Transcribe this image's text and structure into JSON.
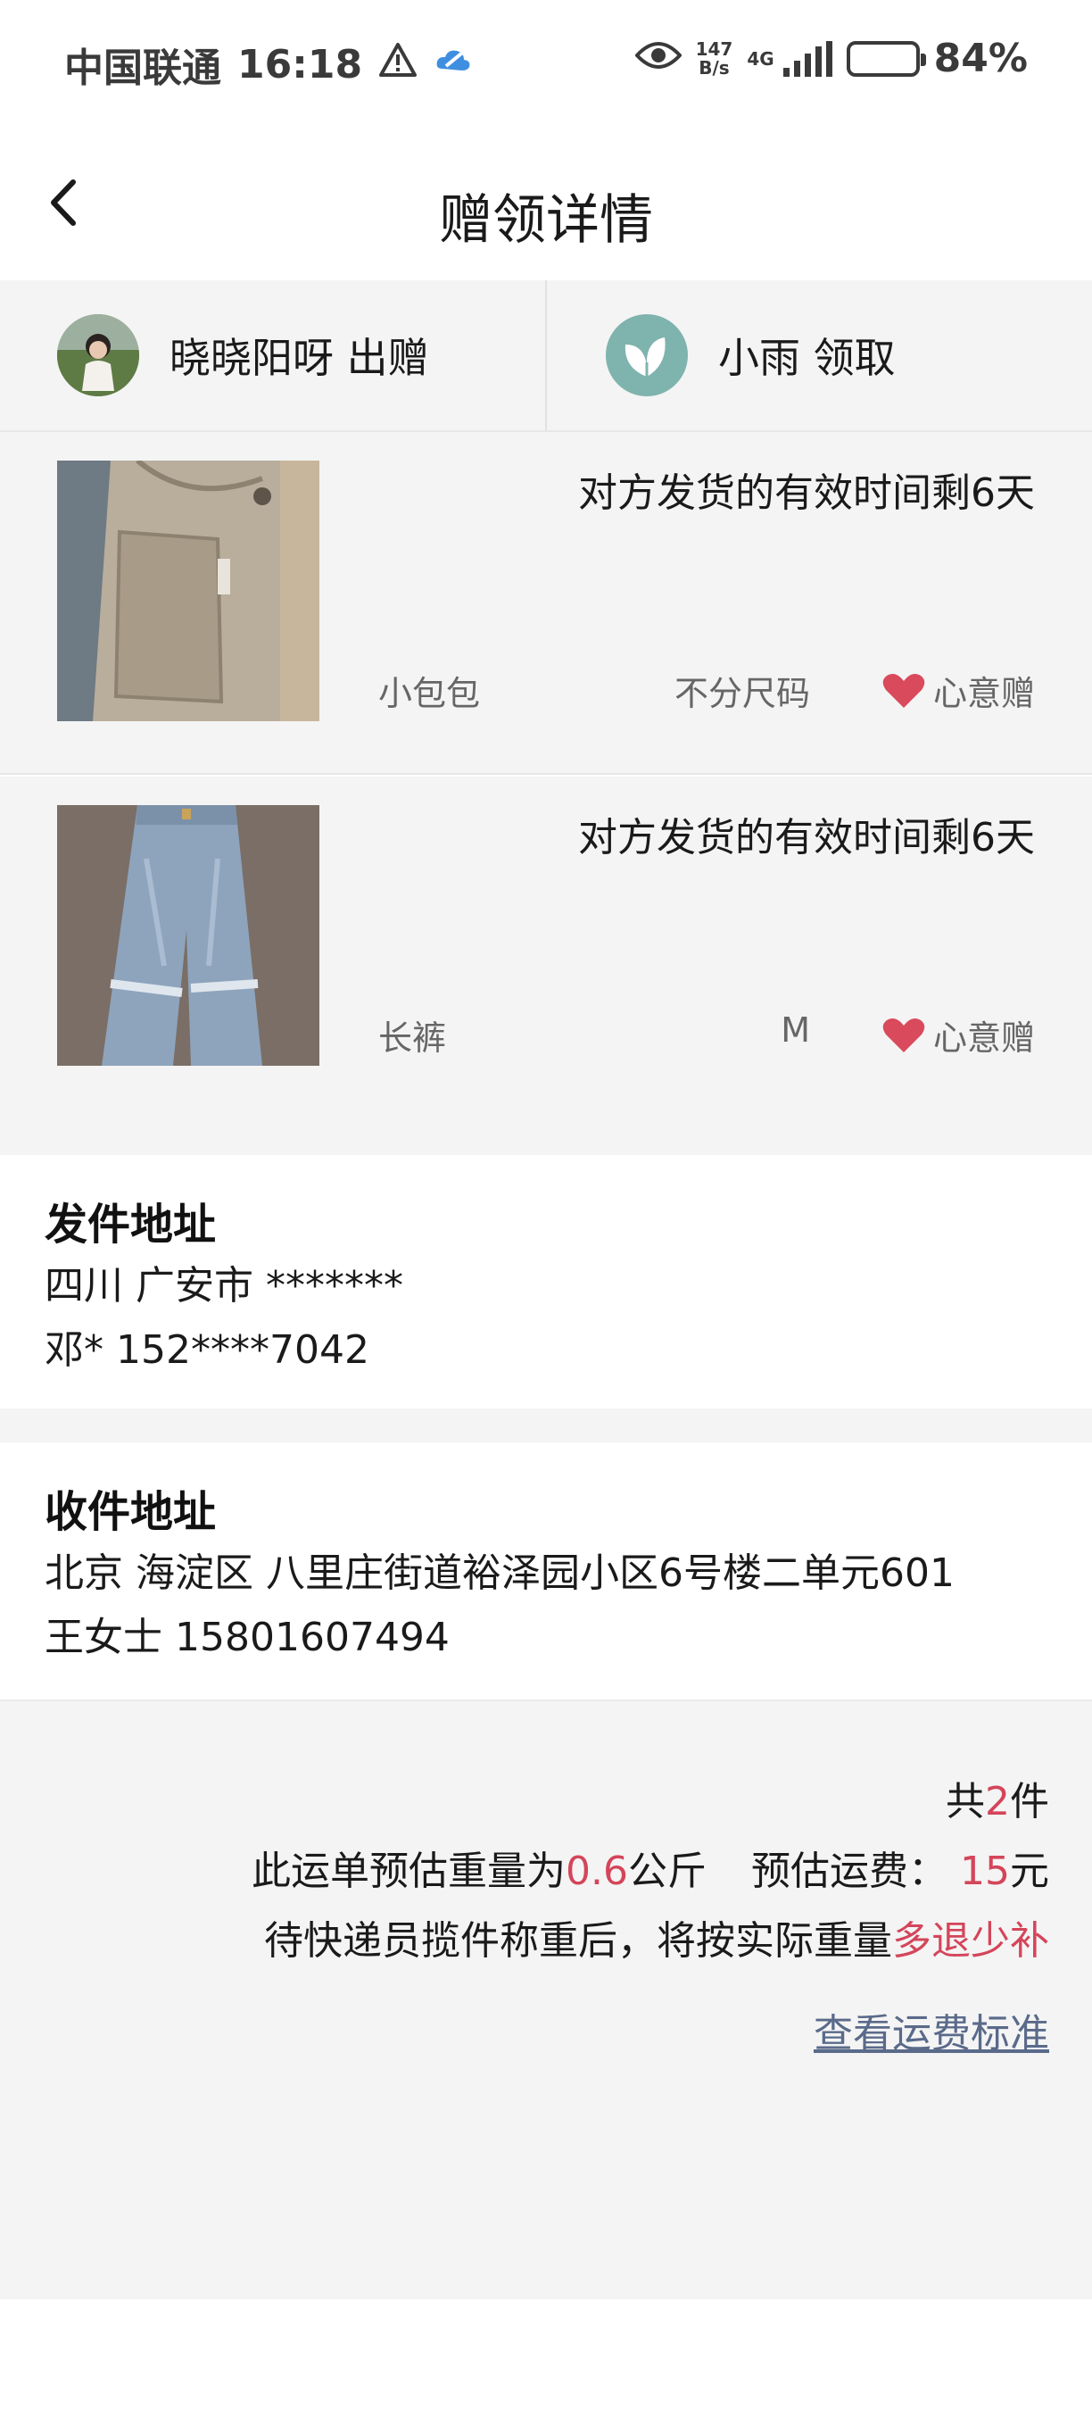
{
  "status_bar": {
    "carrier": "中国联通",
    "time": "16:18",
    "net_speed_value": "147",
    "net_speed_unit": "B/s",
    "network": "4G",
    "battery": "84%",
    "battery_level": 0.84
  },
  "nav": {
    "title": "赠领详情"
  },
  "parties": {
    "giver": {
      "name": "晓晓阳呀 出赠"
    },
    "receiver": {
      "name": "小雨 领取"
    }
  },
  "items": [
    {
      "timer": "对方发货的有效时间剩6天",
      "name": "小包包",
      "size": "不分尺码",
      "gift_label": "心意赠"
    },
    {
      "timer": "对方发货的有效时间剩6天",
      "name": "长裤",
      "size": "M",
      "gift_label": "心意赠"
    }
  ],
  "sender": {
    "heading": "发件地址",
    "address": "四川 广安市 *******",
    "contact": "邓* 152****7042"
  },
  "receiver_address": {
    "heading": "收件地址",
    "address": "北京 海淀区 八里庄街道裕泽园小区6号楼二单元601",
    "contact": "王女士 15801607494"
  },
  "summary": {
    "total_prefix": "共",
    "total_count": "2",
    "total_suffix": "件",
    "weight_prefix": "此运单预估重量为",
    "weight_value": "0.6",
    "weight_unit": "公斤",
    "fee_prefix": "预估运费：",
    "fee_value": "15",
    "fee_unit": "元",
    "note_prefix": "待快递员揽件称重后，将按实际重量",
    "note_highlight": "多退少补",
    "link": "查看运费标准"
  },
  "colors": {
    "accent_red": "#d4455a",
    "link": "#5a6a8a",
    "background_gray": "#f4f4f4"
  }
}
